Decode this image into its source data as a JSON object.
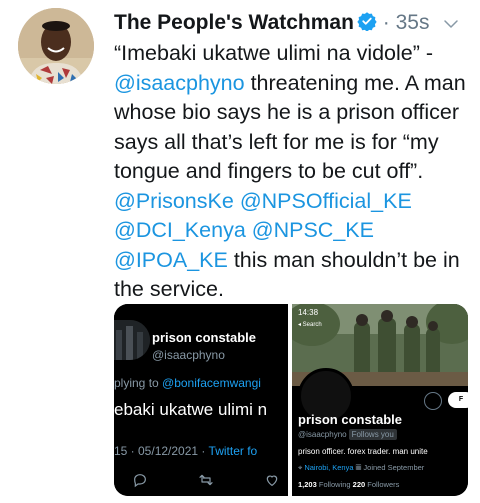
{
  "tweet": {
    "author_name": "The People's Watchman",
    "separator": "·",
    "timestamp": "35s",
    "body": {
      "p1": "“Imebaki ukatwe ulimi na vidole” -",
      "m1": "@isaacphyno",
      "p2": " threatening me. A man whose bio says he is a prison officer says all that’s left for me is for “my tongue and fingers to be cut off”.  ",
      "m2": "@PrisonsKe",
      "m3": "@NPSOfficial_KE",
      "m4": "@DCI_Kenya",
      "m5": "@NPSC_KE",
      "m6": "@IPOA_KE",
      "p3": " this man shouldn’t be in the service."
    }
  },
  "media": {
    "left": {
      "name": "prison constable",
      "handle": "@isaacphyno",
      "reply_prefix": "plying to ",
      "reply_mention": "@bonifacemwangi",
      "text": "ebaki ukatwe ulimi n",
      "meta_time": "15 · 05/12/2021 · ",
      "meta_client": "Twitter fo"
    },
    "right": {
      "status_time": "14:38",
      "search_label": "◂ Search",
      "follow_label": "F",
      "name": "prison constable",
      "handle": "@isaacphyno",
      "follows_you": "Follows you",
      "bio": "prison officer. forex trader. man unite",
      "location": "Nairobi, Kenya",
      "joined": "Joined September",
      "following_count": "1,203",
      "following_label": "Following",
      "followers_count": "220",
      "followers_label": "Followers"
    }
  },
  "colors": {
    "link": "#1b95e0",
    "text": "#14171a",
    "muted": "#657786",
    "verified": "#1da1f2"
  }
}
